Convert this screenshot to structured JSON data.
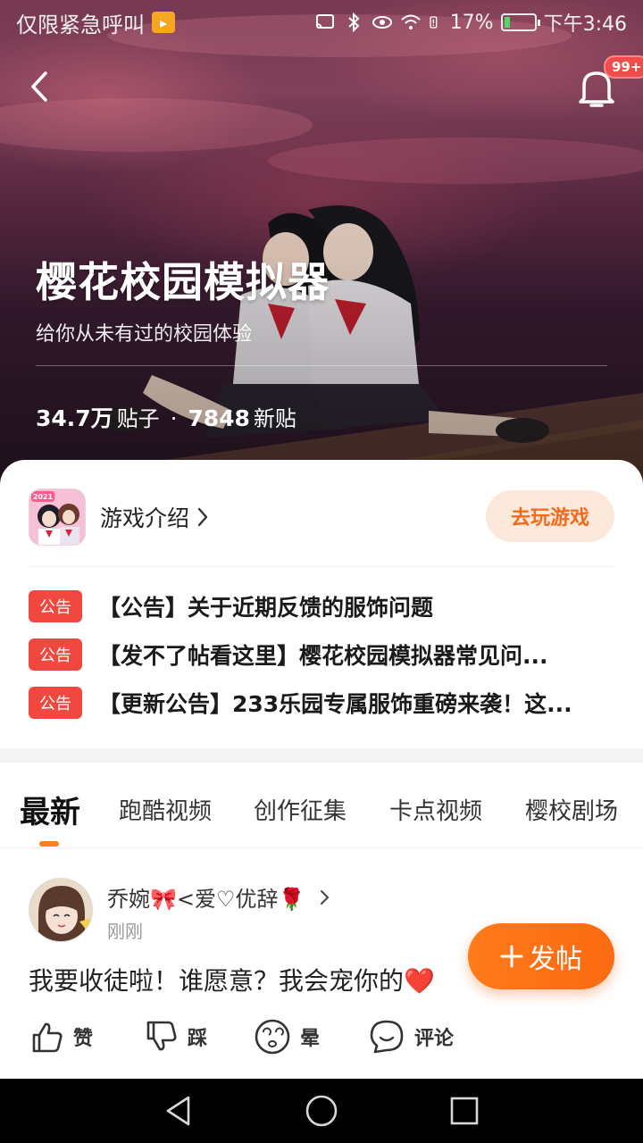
{
  "status_bar": {
    "carrier": "仅限紧急呼叫",
    "battery_percent": "17%",
    "battery_level": 0.17,
    "time": "下午3:46"
  },
  "header": {
    "notification_badge": "99+"
  },
  "hero": {
    "title": "樱花校园模拟器",
    "subtitle": "给你从未有过的校园体验",
    "posts_count": "34.7万",
    "posts_label": "贴子",
    "separator": "·",
    "new_count": "7848",
    "new_label": "新贴"
  },
  "card": {
    "icon_label": "2021",
    "intro_label": "游戏介绍",
    "play_button": "去玩游戏",
    "notices": [
      {
        "tag": "公告",
        "text": "【公告】关于近期反馈的服饰问题"
      },
      {
        "tag": "公告",
        "text": "【发不了帖看这里】樱花校园模拟器常见问..."
      },
      {
        "tag": "公告",
        "text": "【更新公告】233乐园专属服饰重磅来袭！这..."
      }
    ]
  },
  "tabs": [
    "最新",
    "跑酷视频",
    "创作征集",
    "卡点视频",
    "樱校剧场"
  ],
  "post": {
    "username": "乔婉🎀<爱♡优辞🌹",
    "time": "刚刚",
    "text": "我要收徒啦！谁愿意？我会宠你的❤️",
    "actions": [
      "赞",
      "踩",
      "晕",
      "评论"
    ]
  },
  "fab": {
    "label": "发帖"
  },
  "colors": {
    "accent": "#f5821f",
    "notice_tag": "#f0483e",
    "play_button_bg": "#fde9dc",
    "play_button_text": "#f26b1d"
  }
}
